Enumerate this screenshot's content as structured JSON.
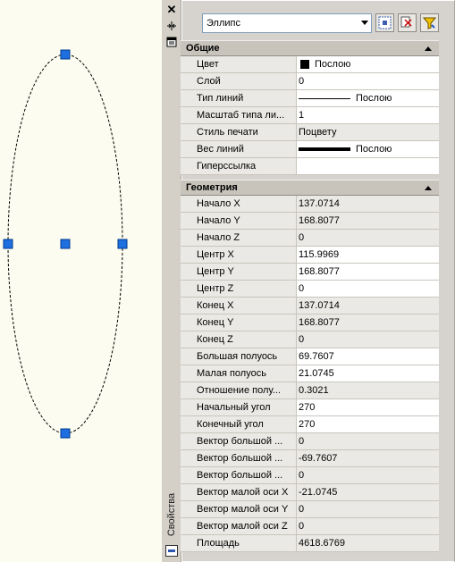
{
  "palette": {
    "title": "Свойства",
    "object_type": "Эллипс"
  },
  "sections": {
    "general": {
      "title": "Общие",
      "rows": [
        {
          "name": "Цвет",
          "value": "Послою"
        },
        {
          "name": "Слой",
          "value": "0"
        },
        {
          "name": "Тип линий",
          "value": "Послою"
        },
        {
          "name": "Масштаб типа ли...",
          "value": "1"
        },
        {
          "name": "Стиль печати",
          "value": "Поцвету"
        },
        {
          "name": "Вес линий",
          "value": "Послою"
        },
        {
          "name": "Гиперссылка",
          "value": ""
        }
      ]
    },
    "geometry": {
      "title": "Геометрия",
      "rows": [
        {
          "name": "Начало X",
          "value": "137.0714"
        },
        {
          "name": "Начало Y",
          "value": "168.8077"
        },
        {
          "name": "Начало Z",
          "value": "0"
        },
        {
          "name": "Центр X",
          "value": "115.9969"
        },
        {
          "name": "Центр Y",
          "value": "168.8077"
        },
        {
          "name": "Центр Z",
          "value": "0"
        },
        {
          "name": "Конец X",
          "value": "137.0714"
        },
        {
          "name": "Конец Y",
          "value": "168.8077"
        },
        {
          "name": "Конец Z",
          "value": "0"
        },
        {
          "name": "Большая полуось",
          "value": "69.7607"
        },
        {
          "name": "Малая полуось",
          "value": "21.0745"
        },
        {
          "name": "Отношение полу...",
          "value": "0.3021"
        },
        {
          "name": "Начальный угол",
          "value": "270"
        },
        {
          "name": "Конечный угол",
          "value": "270"
        },
        {
          "name": "Вектор большой ...",
          "value": "0"
        },
        {
          "name": "Вектор большой ...",
          "value": "-69.7607"
        },
        {
          "name": "Вектор большой ...",
          "value": "0"
        },
        {
          "name": "Вектор малой оси X",
          "value": "-21.0745"
        },
        {
          "name": "Вектор малой оси Y",
          "value": "0"
        },
        {
          "name": "Вектор малой оси Z",
          "value": "0"
        },
        {
          "name": "Площадь",
          "value": "4618.6769"
        }
      ]
    }
  },
  "colors": {
    "grip": "#1e6fe0",
    "canvas_bg": "#fdfcf0",
    "panel_bg": "#d6d3ce"
  }
}
